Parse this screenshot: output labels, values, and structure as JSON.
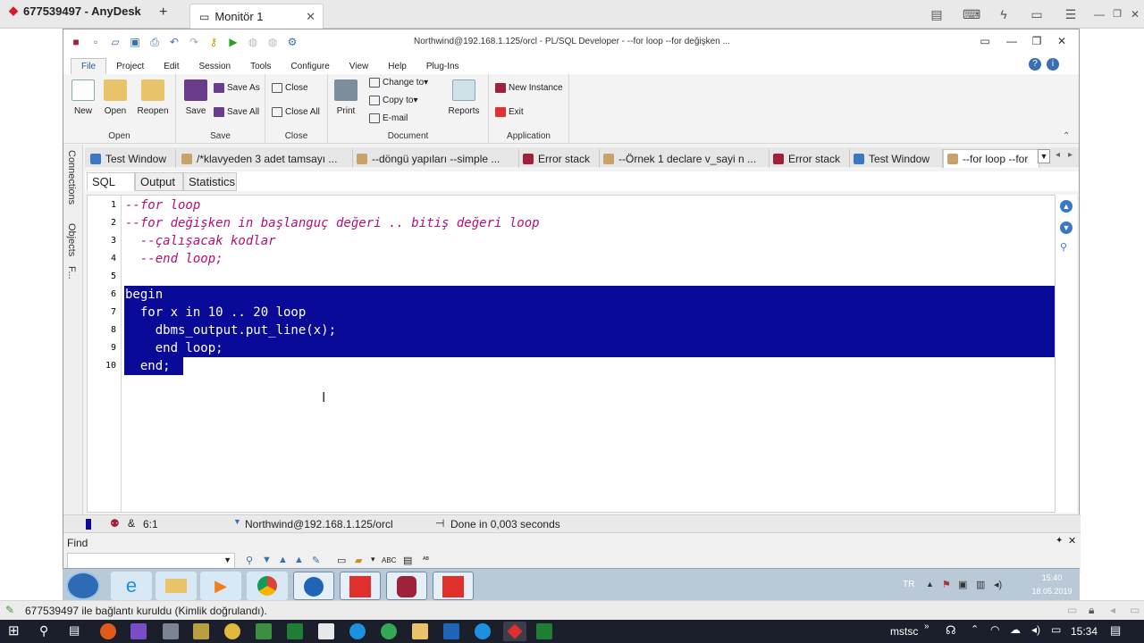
{
  "anydesk": {
    "session": "677539497 - AnyDesk",
    "tab": "Monitör 1",
    "status": "677539497 ile bağlantı kuruldu (Kimlik doğrulandı)."
  },
  "title": "Northwind@192.168.1.125/orcl - PL/SQL Developer - --for loop --for değişken ...",
  "menu": [
    "File",
    "Project",
    "Edit",
    "Session",
    "Tools",
    "Configure",
    "View",
    "Help",
    "Plug-Ins"
  ],
  "ribbon": {
    "open": {
      "label": "Open",
      "new": "New",
      "open": "Open",
      "reopen": "Reopen"
    },
    "save": {
      "label": "Save",
      "save": "Save",
      "save_as": "Save As",
      "save_all": "Save All"
    },
    "close": {
      "label": "Close",
      "close": "Close",
      "close_all": "Close All"
    },
    "document": {
      "label": "Document",
      "print": "Print",
      "change_to": "Change to",
      "copy_to": "Copy to",
      "email": "E-mail",
      "reports": "Reports"
    },
    "application": {
      "label": "Application",
      "new_instance": "New Instance",
      "exit": "Exit"
    }
  },
  "side_tabs": [
    "Connections",
    "Objects",
    "F..."
  ],
  "doc_tabs": [
    "Test Window",
    "/*klavyeden 3 adet tamsayı ...",
    "--döngü yapıları --simple ...",
    "Error stack",
    "--Örnek 1 declare v_sayi n ...",
    "Error stack",
    "Test Window",
    "--for loop --for"
  ],
  "sub_tabs": [
    "SQL",
    "Output",
    "Statistics"
  ],
  "code_lines": [
    {
      "n": "1",
      "text": "--for loop",
      "type": "comment"
    },
    {
      "n": "2",
      "text": "--for değişken in başlanguç değeri .. bitiş değeri loop",
      "type": "comment"
    },
    {
      "n": "3",
      "text": "  --çalışacak kodlar",
      "type": "comment"
    },
    {
      "n": "4",
      "text": "  --end loop;",
      "type": "comment"
    },
    {
      "n": "5",
      "text": "",
      "type": "plain"
    },
    {
      "n": "6",
      "text": "begin",
      "type": "selected"
    },
    {
      "n": "7",
      "text": "  for x in 10 .. 20 loop",
      "type": "selected"
    },
    {
      "n": "8",
      "text": "    dbms_output.put_line(x);",
      "type": "selected"
    },
    {
      "n": "9",
      "text": "    end loop;",
      "type": "selected"
    },
    {
      "n": "10",
      "text": "  end;",
      "type": "selected"
    }
  ],
  "status": {
    "pos": "6:1",
    "connection": "Northwind@192.168.1.125/orcl",
    "message": "Done in 0,003 seconds"
  },
  "find": {
    "label": "Find",
    "value": ""
  },
  "tray": {
    "lang": "TR",
    "time": "15:40",
    "date": "18.05.2019"
  },
  "win10": {
    "user": "mstsc",
    "time": "15:34"
  },
  "colors": {
    "selection": "#0a0a99",
    "comment": "#b0107a",
    "accent": "#2b579a"
  }
}
